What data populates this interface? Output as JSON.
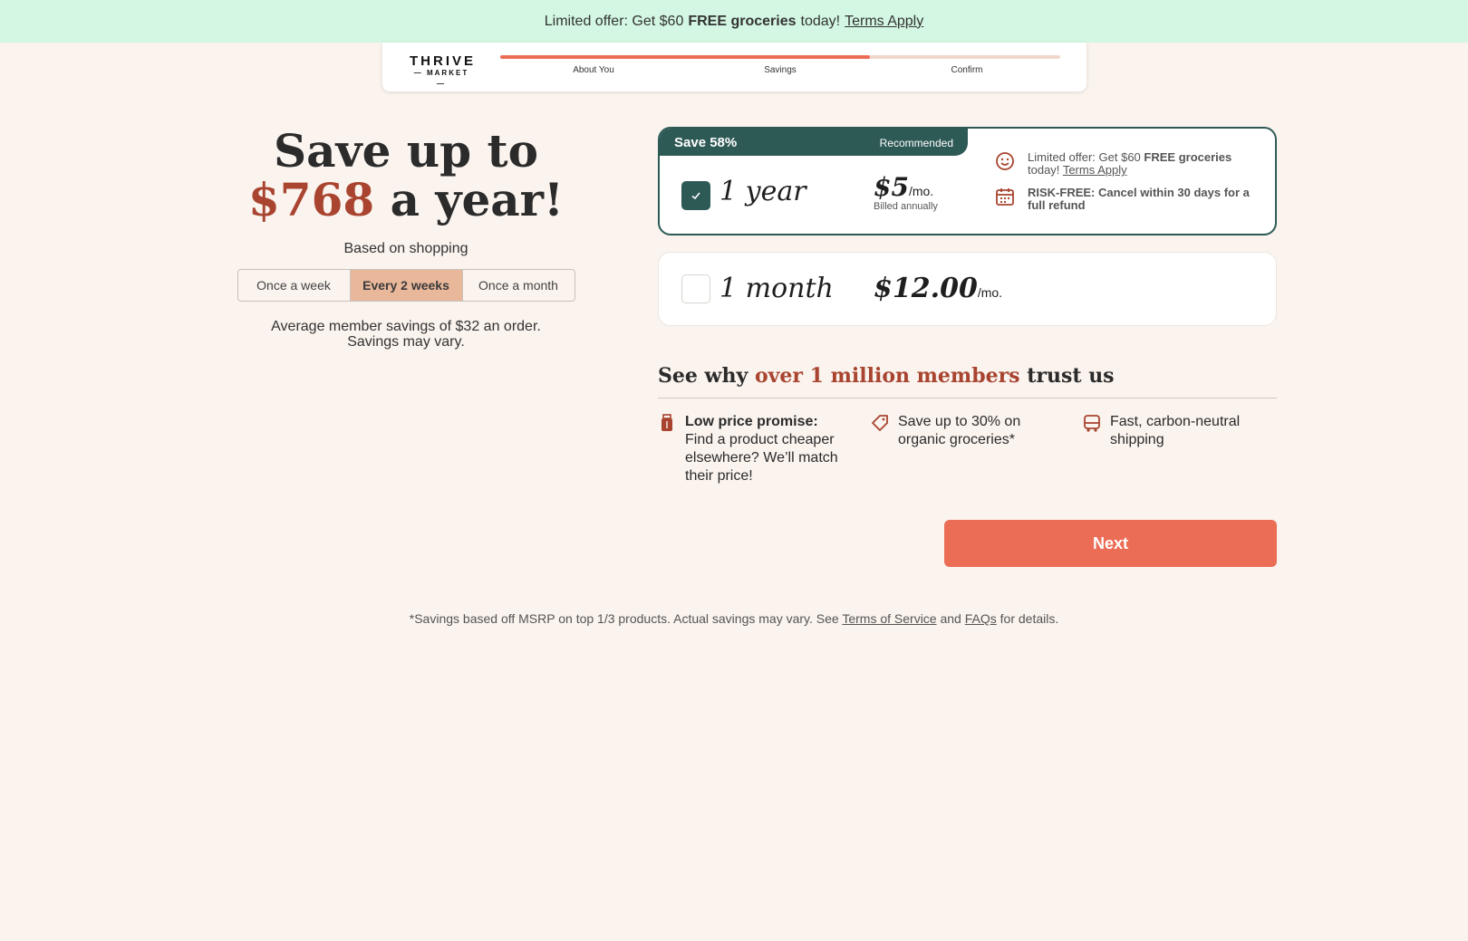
{
  "promo": {
    "text_before": "Limited offer: Get $60",
    "bold": "FREE groceries",
    "text_after": "today!",
    "link": "Terms Apply"
  },
  "header": {
    "logo_top": "THRIVE",
    "logo_bottom": "— MARKET —",
    "steps": [
      {
        "label": "About You",
        "state": "complete"
      },
      {
        "label": "Savings",
        "state": "complete"
      },
      {
        "label": "Confirm",
        "state": "upcoming"
      }
    ],
    "progress_fraction": 0.66
  },
  "hero": {
    "headline_line1": "Save up to",
    "amount": "$768",
    "headline_line2_rest": "a year!",
    "based_on": "Based on shopping",
    "frequency_options": [
      "Once a week",
      "Every 2 weeks",
      "Once a month"
    ],
    "frequency_selected": "Every 2 weeks",
    "avg_line1": "Average member savings of $32 an order.",
    "avg_line2": "Savings may vary."
  },
  "plans": {
    "annual": {
      "save_badge": "Save 58%",
      "recommended": "Recommended",
      "term": "1 year",
      "price": "$5",
      "per": "/mo.",
      "billed": "Billed annually",
      "selected": true,
      "perk1_before": "Limited offer: Get $60",
      "perk1_bold": "FREE groceries",
      "perk1_after": "today!",
      "perk1_link": "Terms Apply",
      "perk2": "RISK-FREE: Cancel within 30 days for a full refund"
    },
    "monthly": {
      "term": "1 month",
      "price": "$12.00",
      "per": "/mo.",
      "selected": false
    }
  },
  "trust": {
    "title_before": "See why",
    "title_accent": "over 1 million members",
    "title_after": "trust us",
    "features": [
      {
        "bold": "Low price promise:",
        "text": "Find a product cheaper elsewhere? We’ll match their price!",
        "icon": "price-tag-jar-icon"
      },
      {
        "bold": "",
        "text": "Save up to 30% on organic groceries*",
        "icon": "tag-icon"
      },
      {
        "bold": "",
        "text": "Fast, carbon-neutral shipping",
        "icon": "truck-icon"
      }
    ]
  },
  "cta": {
    "next_label": "Next"
  },
  "footnote": {
    "before": "*Savings based off MSRP on top 1/3 products. Actual savings may vary. See",
    "tos": "Terms of Service",
    "and": "and",
    "faqs": "FAQs",
    "after": "for details."
  },
  "colors": {
    "background": "#faf3ee",
    "promo_bg": "#d3f7e2",
    "accent": "#a8442f",
    "primary_button": "#ec6d55",
    "selected_plan": "#2e5a56",
    "progress_fill": "#ec6d55"
  }
}
